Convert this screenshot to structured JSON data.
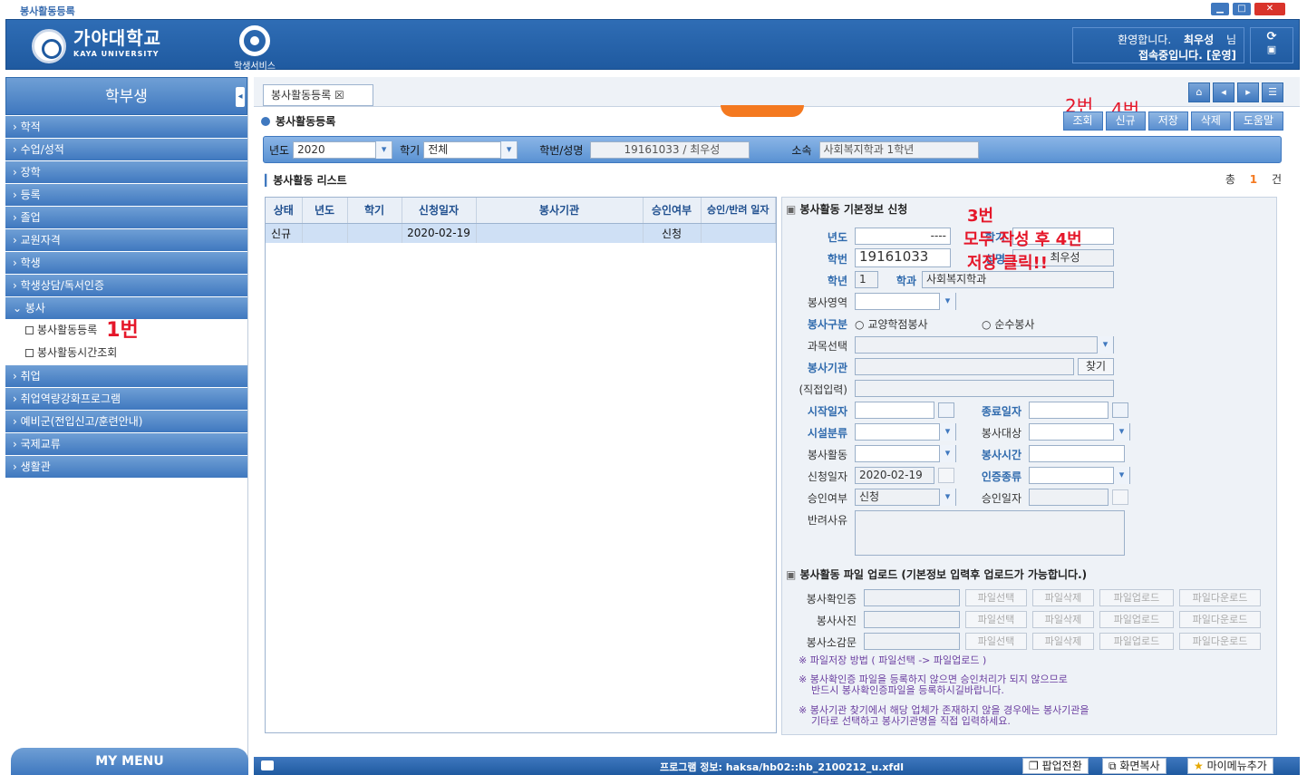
{
  "window": {
    "title": "봉사활동등록"
  },
  "header": {
    "logo_kr": "가야대학교",
    "logo_en": "KAYA UNIVERSITY",
    "service_label": "학생서비스",
    "welcome": "환영합니다.",
    "user_name": "최우성",
    "honorific": "님",
    "status": "접속중입니다. [운영]"
  },
  "sidebar": {
    "title": "학부생",
    "menu": [
      "학적",
      "수업/성적",
      "장학",
      "등록",
      "졸업",
      "교원자격",
      "학생",
      "학생상담/독서인증",
      "봉사"
    ],
    "sub": [
      "봉사활동등록",
      "봉사활동시간조회"
    ],
    "menu2": [
      "취업",
      "취업역량강화프로그램",
      "예비군(전입신고/훈련안내)",
      "국제교류",
      "생활관"
    ],
    "my_menu": "MY MENU"
  },
  "annotations": {
    "step1": "1번",
    "step2": "2번",
    "step4": "4번",
    "step3": "3번",
    "step3_line1": "모두 작성 후 4번",
    "step3_line2": "저장 클릭!!"
  },
  "tab": {
    "label": "봉사활동등록 ☒"
  },
  "page_title": "봉사활동등록",
  "toolbar": {
    "search": "조회",
    "new": "신규",
    "save": "저장",
    "delete": "삭제",
    "help": "도움말"
  },
  "cond": {
    "year_label": "년도",
    "year": "2020",
    "term_label": "학기",
    "term": "전체",
    "id_label": "학번/성명",
    "id_value": "19161033 / 최우성",
    "dept_label": "소속",
    "dept_value": "사회복지학과 1학년"
  },
  "list": {
    "title": "봉사활동 리스트",
    "total_label": "총",
    "total_count": "1",
    "total_unit": "건",
    "columns": [
      "상태",
      "년도",
      "학기",
      "신청일자",
      "봉사기관",
      "승인여부",
      "승인/반려 일자"
    ],
    "rows": [
      [
        "신규",
        "",
        "",
        "2020-02-19",
        "",
        "신청",
        ""
      ]
    ]
  },
  "form": {
    "section_title": "봉사활동 기본정보 신청",
    "year_label": "년도",
    "year_value": "----",
    "term_label": "학기",
    "sid_label": "학번",
    "sid_value": "19161033",
    "name_label": "성명",
    "name_value": "최우성",
    "grade_label": "학년",
    "grade_value": "1",
    "dept_label": "학과",
    "dept_value": "사회복지학과",
    "area_label": "봉사영역",
    "type_label": "봉사구분",
    "type_opt1": "교양학점봉사",
    "type_opt2": "순수봉사",
    "subject_label": "과목선택",
    "org_label": "봉사기관",
    "find": "찾기",
    "direct_label": "(직접입력)",
    "start_label": "시작일자",
    "end_label": "종료일자",
    "fac_label": "시설분류",
    "target_label": "봉사대상",
    "act_label": "봉사활동",
    "hours_label": "봉사시간",
    "apply_label": "신청일자",
    "apply_value": "2020-02-19",
    "cert_label": "인증종류",
    "approve_label": "승인여부",
    "approve_value": "신청",
    "approve_date_label": "승인일자",
    "reject_label": "반려사유"
  },
  "upload": {
    "title": "봉사활동 파일 업로드 (기본정보 입력후 업로드가 가능합니다.)",
    "rows": [
      "봉사확인증",
      "봉사사진",
      "봉사소감문"
    ],
    "btn_select": "파일선택",
    "btn_delete": "파일삭제",
    "btn_upload": "파일업로드",
    "btn_download": "파일다운로드",
    "note1": "※ 파일저장 방법 ( 파일선택 -> 파일업로드 )",
    "note2": "※ 봉사확인증 파일을 등록하지 않으면 승인처리가 되지 않으므로\n    반드시 봉사확인증파일을 등록하시길바랍니다.",
    "note3": "※ 봉사기관 찾기에서 해당 업체가 존재하지 않을 경우에는 봉사기관을\n    기타로 선택하고 봉사기관명을 직접 입력하세요."
  },
  "statusbar": {
    "program": "프로그램 정보: haksa/hb02::hb_2100212_u.xfdl",
    "popup": "팝업전환",
    "copy": "화면복사",
    "add_menu": "마이메뉴추가"
  }
}
